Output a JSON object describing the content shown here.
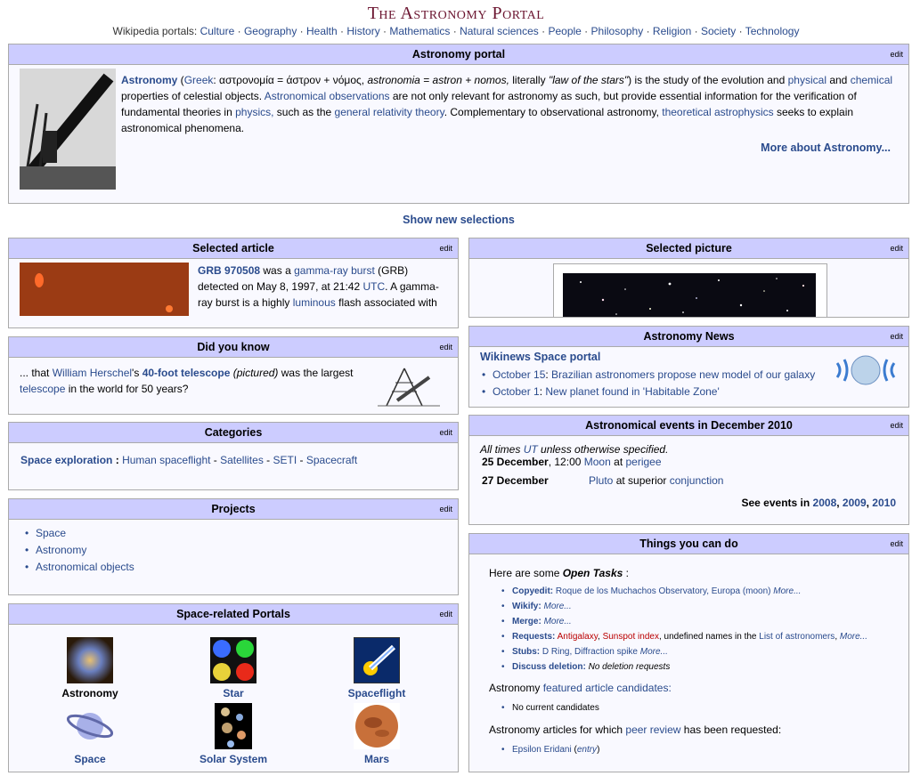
{
  "title": "The Astronomy Portal",
  "portal_nav": {
    "prefix": "Wikipedia portals:",
    "items": [
      "Culture",
      "Geography",
      "Health",
      "History",
      "Mathematics",
      "Natural sciences",
      "People",
      "Philosophy",
      "Religion",
      "Society",
      "Technology"
    ]
  },
  "edit_label": "edit",
  "intro": {
    "header": "Astronomy portal",
    "astronomy": "Astronomy",
    "greek_link": "Greek",
    "greek_text": ": αστρονομία = άστρον + νόμος,",
    "astronomia": "astronomia = astron + nomos,",
    "literally": "literally",
    "law": "\"law of the stars\"",
    "study": ") is the study of the evolution and",
    "physical": "physical",
    "and": "and",
    "chemical": "chemical",
    "props": "properties of celestial objects.",
    "obs": "Astronomical observations",
    "not_only": "are not only relevant for astronomy as such, but provide essential information for the verification of fundamental theories in",
    "physics": "physics,",
    "such_as": "such as the",
    "gr": "general relativity theory",
    "complement": ". Complementary to observational astronomy,",
    "ta": "theoretical astrophysics",
    "seeks": "seeks to explain astronomical phenomena.",
    "more": "More about Astronomy..."
  },
  "show_new": "Show new selections",
  "selected_article": {
    "header": "Selected article",
    "grb": "GRB 970508",
    "was_a": "was a",
    "gamma": "gamma-ray burst",
    "grb_abbr": "(GRB) detected on May 8, 1997, at 21:42",
    "utc": "UTC",
    "rest": ". A gamma-ray burst is a highly",
    "luminous": "luminous",
    "flash": "flash associated with"
  },
  "did_you_know": {
    "header": "Did you know",
    "that": "... that",
    "herschel": "William Herschel",
    "s": "'s",
    "telescope40": "40-foot telescope",
    "pictured": "(pictured)",
    "largest": "was the largest",
    "telescope": "telescope",
    "world": "in the world for 50 years?"
  },
  "categories": {
    "header": "Categories",
    "main": "Space exploration",
    "sep": ":",
    "items": [
      "Human spaceflight",
      "Satellites",
      "SETI",
      "Spacecraft"
    ]
  },
  "projects": {
    "header": "Projects",
    "items": [
      "Space",
      "Astronomy",
      "Astronomical objects"
    ]
  },
  "space_portals": {
    "header": "Space-related Portals",
    "items": [
      "Astronomy",
      "Star",
      "Spaceflight",
      "Space",
      "Solar System",
      "Mars"
    ]
  },
  "selected_picture": {
    "header": "Selected picture"
  },
  "news": {
    "header": "Astronomy News",
    "portal": "Wikinews Space portal",
    "items": [
      {
        "date": "October 15",
        "text": "Brazilian astronomers propose new model of our galaxy"
      },
      {
        "date": "October 1",
        "text": "New planet found in 'Habitable Zone'"
      }
    ]
  },
  "events": {
    "header": "Astronomical events in December 2010",
    "note_pre": "All times",
    "note_utc": "UT",
    "note_post": "unless otherwise specified.",
    "row1_date": "25 December",
    "row1_time": ", 12:00",
    "row1_moon": "Moon",
    "row1_at": "at",
    "row1_perigee": "perigee",
    "row2_date": "27 December",
    "row2_pluto": "Pluto",
    "row2_text": "at superior",
    "row2_conj": "conjunction",
    "see": "See events in",
    "years": [
      "2008",
      "2009",
      "2010"
    ]
  },
  "things": {
    "header": "Things you can do",
    "intro_pre": "Here are some",
    "intro_open": "Open Tasks",
    "intro_colon": ":",
    "more": "More...",
    "copyedit_label": "Copyedit:",
    "copyedit_items": "Roque de los Muchachos Observatory, Europa (moon)",
    "wikify_label": "Wikify:",
    "merge_label": "Merge:",
    "requests_label": "Requests:",
    "req_1": "Antigalaxy",
    "req_2": "Sunspot index",
    "req_3": ", undefined names in the",
    "req_4": "List of astronomers",
    "stubs_label": "Stubs:",
    "stubs_items": "D Ring, Diffraction spike",
    "discuss_label": "Discuss deletion:",
    "discuss_text": "No deletion requests",
    "fac_pre": "Astronomy",
    "fac_link": "featured article candidates:",
    "fac_item": "No current candidates",
    "pr_pre": "Astronomy articles for which",
    "pr_link": "peer review",
    "pr_post": "has been requested:",
    "pr_item": "Epsilon Eridani",
    "pr_entry": "entry"
  }
}
